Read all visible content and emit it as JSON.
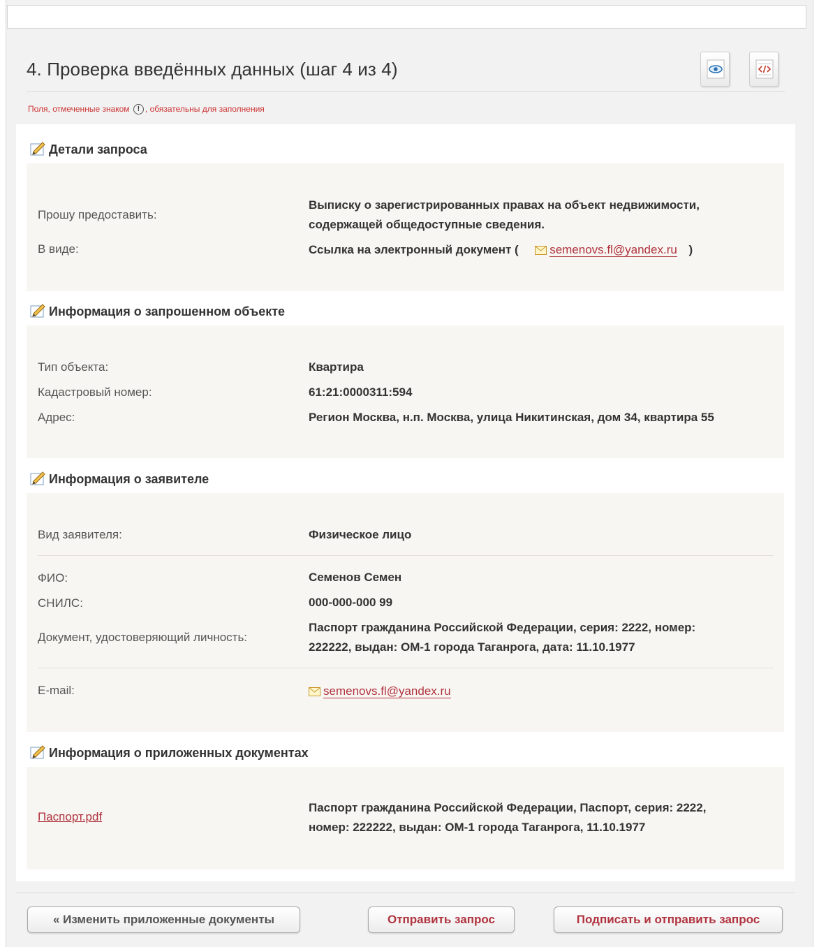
{
  "page": {
    "title": "4. Проверка введённых данных (шаг 4 из 4)",
    "required_note_before": "Поля, отмеченные знаком",
    "required_mark": "!",
    "required_note_after": ", обязательны для заполнения",
    "icons": [
      "preview-icon",
      "xml-code-icon"
    ]
  },
  "sections": {
    "request": {
      "heading": "Детали запроса",
      "rows": {
        "provide_label": "Прошу предоставить:",
        "provide_value_line1": "Выписку о зарегистрированных правах на объект недвижимости,",
        "provide_value_line2": "содержащей общедоступные сведения.",
        "form_label": "В виде:",
        "form_value_prefix": "Ссылка на электронный документ (",
        "form_value_email": "semenovs.fl@yandex.ru",
        "form_value_suffix": ")"
      }
    },
    "object": {
      "heading": "Информация о запрошенном объекте",
      "rows": {
        "type_label": "Тип объекта:",
        "type_value": "Квартира",
        "cadastral_label": "Кадастровый номер:",
        "cadastral_value": "61:21:0000311:594",
        "address_label": "Адрес:",
        "address_value": "Регион Москва, н.п. Москва, улица Никитинская, дом 34, квартира 55"
      }
    },
    "applicant": {
      "heading": "Информация о заявителе",
      "rows": {
        "kind_label": "Вид заявителя:",
        "kind_value": "Физическое лицо",
        "fio_label": "ФИО:",
        "fio_value": "Семенов Семен",
        "snils_label": "СНИЛС:",
        "snils_value": "000-000-000 99",
        "id_doc_label": "Документ, удостоверяющий личность:",
        "id_doc_value_line1": "Паспорт гражданина Российской Федерации, серия: 2222, номер:",
        "id_doc_value_line2": "222222, выдан: ОМ-1 города Таганрога, дата: 11.10.1977",
        "email_label": "E-mail:",
        "email_value": "semenovs.fl@yandex.ru"
      }
    },
    "documents": {
      "heading": "Информация о приложенных документах",
      "file_name": "Паспорт.pdf",
      "desc_line1": "Паспорт гражданина Российской Федерации, Паспорт, серия: 2222,",
      "desc_line2": "номер: 222222, выдан: ОМ-1 города Таганрога, 11.10.1977"
    }
  },
  "buttons": {
    "back": "« Изменить приложенные документы",
    "send": "Отправить запрос",
    "sign_send": "Подписать и отправить запрос"
  },
  "colors": {
    "accent_red": "#b0333f",
    "panel_bg": "#f8f6f2",
    "frame_bg": "#f2f2f2"
  }
}
